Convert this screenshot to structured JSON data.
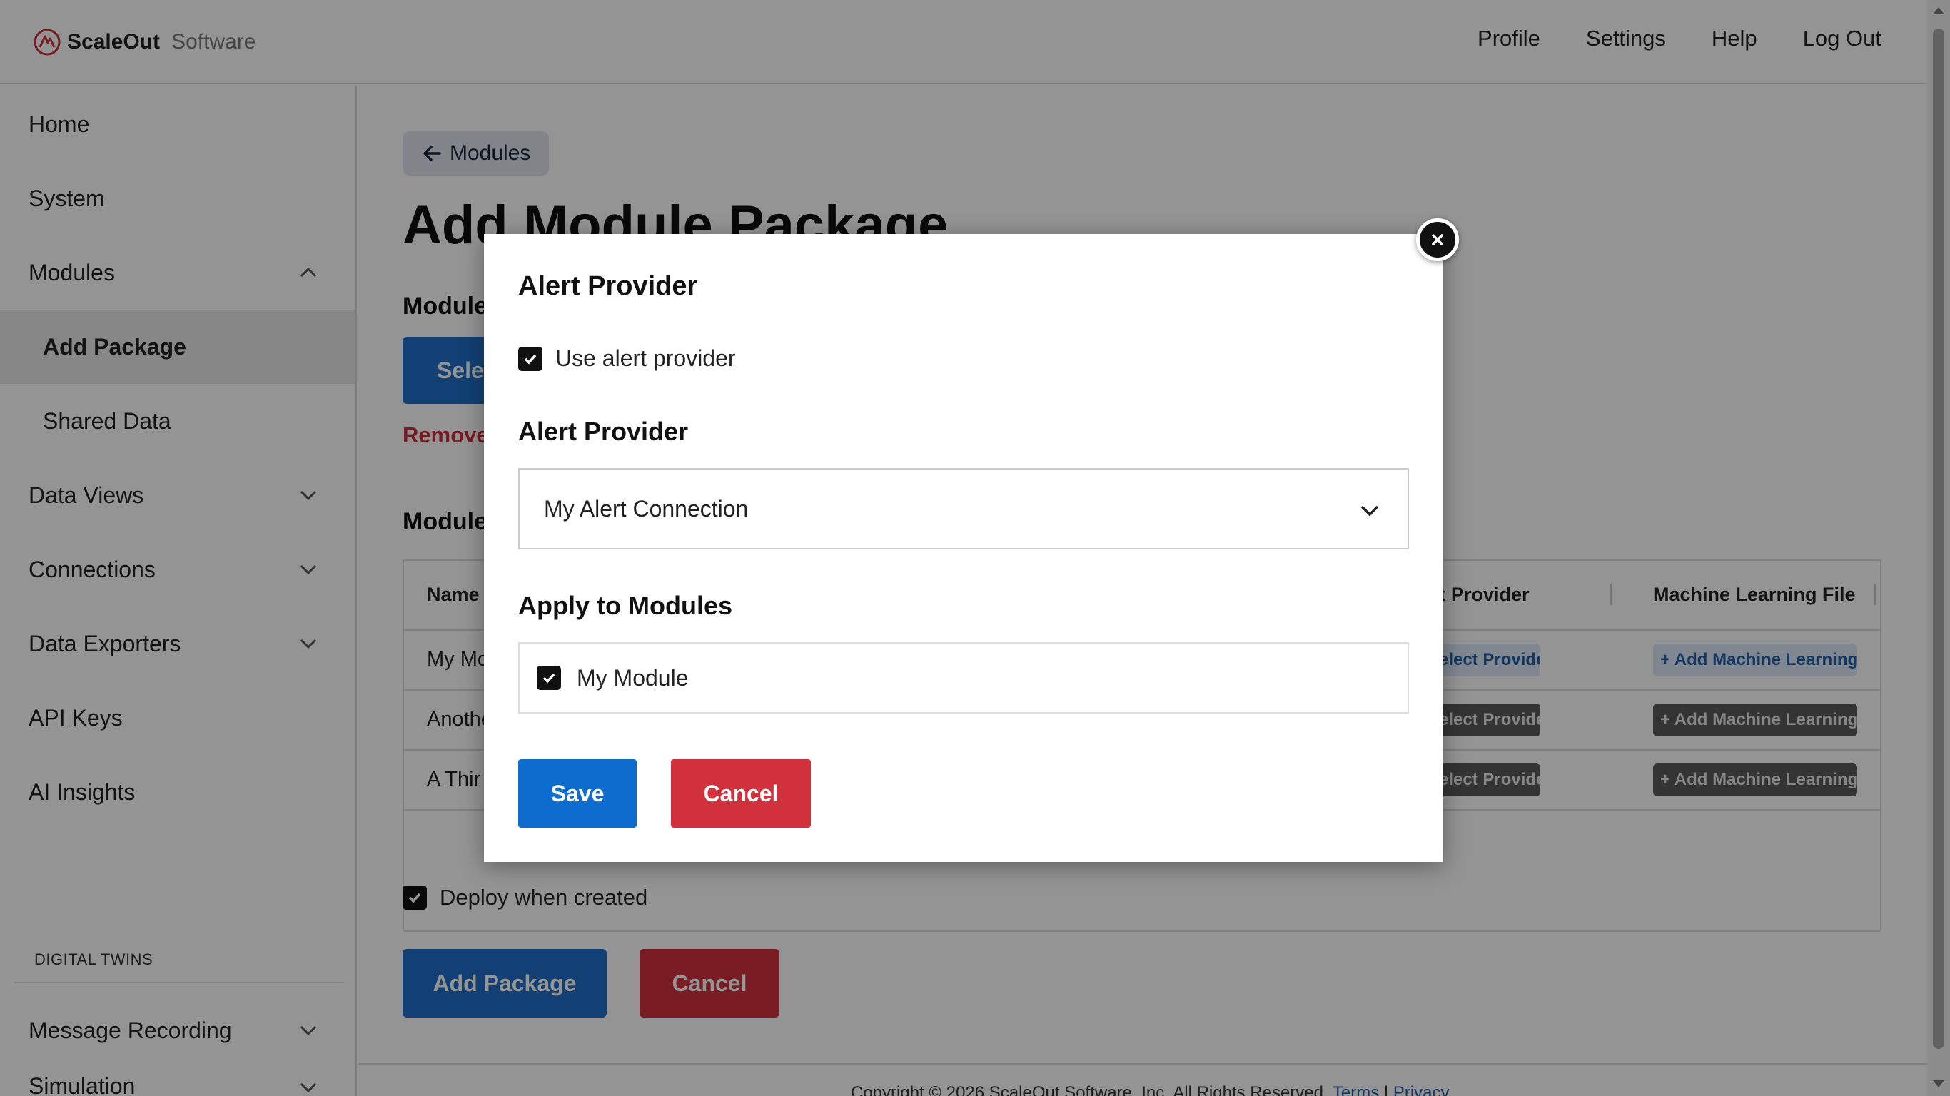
{
  "header": {
    "brand_primary": "ScaleOut",
    "brand_secondary": "Software",
    "nav": [
      "Profile",
      "Settings",
      "Help",
      "Log Out"
    ]
  },
  "sidebar": {
    "items": [
      {
        "label": "Home",
        "icon": "none"
      },
      {
        "label": "System",
        "icon": "none"
      },
      {
        "label": "Modules",
        "icon": "chevron-up-icon"
      },
      {
        "label": "Add Package",
        "icon": "none",
        "active": true
      },
      {
        "label": "Shared Data",
        "icon": "none"
      },
      {
        "label": "Data Views",
        "icon": "chevron-down-icon"
      },
      {
        "label": "Connections",
        "icon": "chevron-down-icon"
      },
      {
        "label": "Data Exporters",
        "icon": "chevron-down-icon"
      },
      {
        "label": "API Keys",
        "icon": "none"
      },
      {
        "label": "AI Insights",
        "icon": "none"
      }
    ],
    "section_label": "DIGITAL TWINS",
    "section_items": [
      {
        "label": "Message Recording",
        "icon": "chevron-down-icon"
      },
      {
        "label": "Simulation",
        "icon": "chevron-down-icon"
      }
    ]
  },
  "main": {
    "back_label": "Modules",
    "title": "Add Module Package",
    "section1": "Module",
    "select_label": "Sele",
    "remove_label": "Remove",
    "section2": "Module",
    "table": {
      "headers": [
        "Name",
        "rt Provider",
        "Machine Learning File"
      ],
      "rows": [
        {
          "name": "My Mo",
          "provider": "elect Provider",
          "ml": "+ Add Machine Learning",
          "style": "blue"
        },
        {
          "name": "Anothe",
          "provider": "elect Provider",
          "ml": "+ Add Machine Learning",
          "style": "gray"
        },
        {
          "name": "A Thir",
          "provider": "elect Provider",
          "ml": "+ Add Machine Learning",
          "style": "gray"
        }
      ]
    },
    "deploy_label": "Deploy when created",
    "deploy_checked": true,
    "add_package_label": "Add Package",
    "cancel_label": "Cancel",
    "footer_text": "Copyright © 2026 ScaleOut Software, Inc. All Rights Reserved.",
    "footer_terms": "Terms",
    "footer_sep": "|",
    "footer_privacy": "Privacy"
  },
  "modal": {
    "title": "Alert Provider",
    "use_provider_label": "Use alert provider",
    "use_provider_checked": true,
    "provider_label": "Alert Provider",
    "provider_value": "My Alert Connection",
    "apply_label": "Apply to Modules",
    "module_label": "My Module",
    "module_checked": true,
    "save_label": "Save",
    "cancel_label": "Cancel"
  },
  "colors": {
    "primary": "#1f6fc8",
    "danger": "#d0313d",
    "brand_red": "#c8323c"
  }
}
